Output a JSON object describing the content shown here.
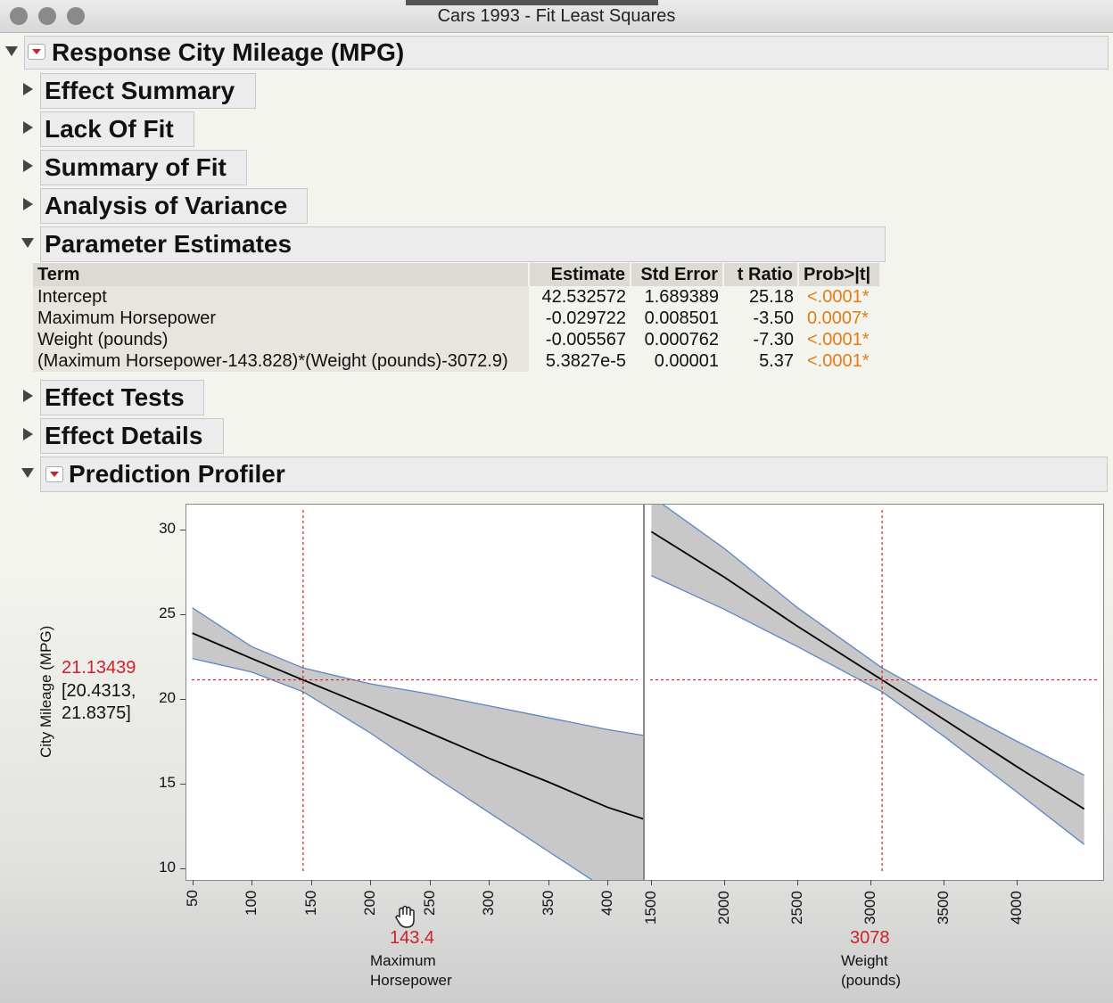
{
  "window": {
    "title": "Cars 1993 - Fit Least Squares"
  },
  "report": {
    "response_title": "Response City Mileage (MPG)",
    "sections": {
      "effect_summary": "Effect Summary",
      "lack_of_fit": "Lack Of Fit",
      "summary_of_fit": "Summary of Fit",
      "analysis_of_variance": "Analysis of Variance",
      "parameter_estimates": "Parameter Estimates",
      "effect_tests": "Effect Tests",
      "effect_details": "Effect Details",
      "prediction_profiler": "Prediction Profiler"
    }
  },
  "parameter_estimates": {
    "headers": {
      "term": "Term",
      "estimate": "Estimate",
      "std_error": "Std Error",
      "t_ratio": "t Ratio",
      "prob": "Prob>|t|"
    },
    "rows": [
      {
        "term": "Intercept",
        "estimate": "42.532572",
        "std_error": "1.689389",
        "t_ratio": "25.18",
        "prob": "<.0001*"
      },
      {
        "term": "Maximum Horsepower",
        "estimate": "-0.029722",
        "std_error": "0.008501",
        "t_ratio": "-3.50",
        "prob": "0.0007*"
      },
      {
        "term": "Weight (pounds)",
        "estimate": "-0.005567",
        "std_error": "0.000762",
        "t_ratio": "-7.30",
        "prob": "<.0001*"
      },
      {
        "term": "(Maximum Horsepower-143.828)*(Weight (pounds)-3072.9)",
        "estimate": "5.3827e-5",
        "std_error": "0.00001",
        "t_ratio": "5.37",
        "prob": "<.0001*"
      }
    ],
    "prob_color": "#e07d17"
  },
  "profiler": {
    "y_label": "City Mileage (MPG)",
    "prediction": "21.13439",
    "ci_line1": "[20.4313,",
    "ci_line2": "21.8375]",
    "x1": {
      "current": "143.4",
      "label_line1": "Maximum",
      "label_line2": "Horsepower"
    },
    "x2": {
      "current": "3078",
      "label_line1": "Weight",
      "label_line2": "(pounds)"
    },
    "accent_red": "#d0202a",
    "band_fill": "#c8c8c8",
    "band_edge": "#5b86c7"
  },
  "chart_data": [
    {
      "type": "line",
      "xlabel": "Maximum Horsepower",
      "ylabel": "City Mileage (MPG)",
      "xlim": [
        45,
        430
      ],
      "ylim": [
        9.3,
        31.5
      ],
      "x_ticks": [
        "50",
        "100",
        "150",
        "200",
        "250",
        "300",
        "350",
        "400"
      ],
      "y_ticks": [
        "10",
        "15",
        "20",
        "25",
        "30"
      ],
      "current_x": 143.4,
      "current_y": 21.13439,
      "x": [
        50,
        100,
        143.4,
        200,
        250,
        300,
        350,
        400,
        435
      ],
      "series": [
        {
          "values": [
            23.9,
            22.4,
            21.13,
            19.5,
            18.0,
            16.5,
            15.1,
            13.6,
            12.8
          ]
        },
        {
          "values": [
            25.4,
            23.1,
            21.84,
            20.9,
            20.3,
            19.6,
            18.9,
            18.2,
            17.8
          ]
        },
        {
          "values": [
            22.4,
            21.6,
            20.43,
            18.0,
            15.6,
            13.3,
            11.0,
            8.7,
            7.6
          ]
        }
      ]
    },
    {
      "type": "line",
      "xlabel": "Weight (pounds)",
      "ylabel": "City Mileage (MPG)",
      "xlim": [
        1455,
        4590
      ],
      "ylim": [
        9.3,
        31.5
      ],
      "x_ticks": [
        "1500",
        "2000",
        "2500",
        "3000",
        "3500",
        "4000"
      ],
      "y_ticks": [
        "10",
        "15",
        "20",
        "25",
        "30"
      ],
      "current_x": 3078,
      "current_y": 21.13439,
      "x": [
        1500,
        2000,
        2500,
        3078,
        3500,
        4000,
        4460
      ],
      "series": [
        {
          "values": [
            29.9,
            27.2,
            24.3,
            21.13,
            18.8,
            16.0,
            13.5
          ]
        },
        {
          "values": [
            32.0,
            28.9,
            25.4,
            21.84,
            19.8,
            17.5,
            15.5
          ]
        },
        {
          "values": [
            27.3,
            25.3,
            23.1,
            20.43,
            17.8,
            14.5,
            11.4
          ]
        }
      ]
    }
  ]
}
